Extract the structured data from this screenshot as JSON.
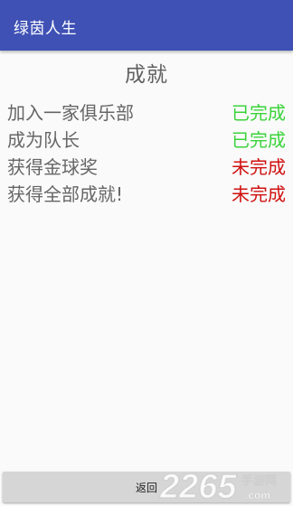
{
  "appbar": {
    "title": "绿茵人生",
    "color": "#3f51b5"
  },
  "page": {
    "title": "成就"
  },
  "achievements": [
    {
      "name": "加入一家俱乐部",
      "status": "已完成",
      "done": true
    },
    {
      "name": "成为队长",
      "status": "已完成",
      "done": true
    },
    {
      "name": "获得金球奖",
      "status": "未完成",
      "done": false
    },
    {
      "name": "获得全部成就!",
      "status": "未完成",
      "done": false
    }
  ],
  "colors": {
    "done": "#3ad33a",
    "todo": "#d01010"
  },
  "footer": {
    "back_label": "返回"
  },
  "watermark": {
    "number": "2265",
    "site": "手游网",
    "domain": ".com"
  }
}
